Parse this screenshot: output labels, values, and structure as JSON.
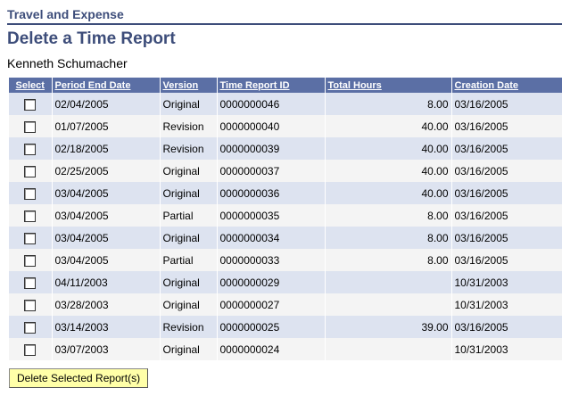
{
  "header": {
    "section_title": "Travel and Expense",
    "page_title": "Delete a Time Report",
    "employee_name": "Kenneth Schumacher"
  },
  "table": {
    "columns": [
      "Select",
      "Period End Date",
      "Version",
      "Time Report ID",
      "Total Hours",
      "Creation Date"
    ],
    "rows": [
      {
        "checked": false,
        "period_end": "02/04/2005",
        "version": "Original",
        "report_id": "0000000046",
        "hours": "8.00",
        "created": "03/16/2005"
      },
      {
        "checked": false,
        "period_end": "01/07/2005",
        "version": "Revision",
        "report_id": "0000000040",
        "hours": "40.00",
        "created": "03/16/2005"
      },
      {
        "checked": false,
        "period_end": "02/18/2005",
        "version": "Revision",
        "report_id": "0000000039",
        "hours": "40.00",
        "created": "03/16/2005"
      },
      {
        "checked": false,
        "period_end": "02/25/2005",
        "version": "Original",
        "report_id": "0000000037",
        "hours": "40.00",
        "created": "03/16/2005"
      },
      {
        "checked": false,
        "period_end": "03/04/2005",
        "version": "Original",
        "report_id": "0000000036",
        "hours": "40.00",
        "created": "03/16/2005"
      },
      {
        "checked": false,
        "period_end": "03/04/2005",
        "version": "Partial",
        "report_id": "0000000035",
        "hours": "8.00",
        "created": "03/16/2005"
      },
      {
        "checked": false,
        "period_end": "03/04/2005",
        "version": "Original",
        "report_id": "0000000034",
        "hours": "8.00",
        "created": "03/16/2005"
      },
      {
        "checked": false,
        "period_end": "03/04/2005",
        "version": "Partial",
        "report_id": "0000000033",
        "hours": "8.00",
        "created": "03/16/2005"
      },
      {
        "checked": false,
        "period_end": "04/11/2003",
        "version": "Original",
        "report_id": "0000000029",
        "hours": "",
        "created": "10/31/2003"
      },
      {
        "checked": false,
        "period_end": "03/28/2003",
        "version": "Original",
        "report_id": "0000000027",
        "hours": "",
        "created": "10/31/2003"
      },
      {
        "checked": false,
        "period_end": "03/14/2003",
        "version": "Revision",
        "report_id": "0000000025",
        "hours": "39.00",
        "created": "03/16/2005"
      },
      {
        "checked": false,
        "period_end": "03/07/2003",
        "version": "Original",
        "report_id": "0000000024",
        "hours": "",
        "created": "10/31/2003"
      }
    ]
  },
  "actions": {
    "delete_label": "Delete Selected Report(s)"
  }
}
